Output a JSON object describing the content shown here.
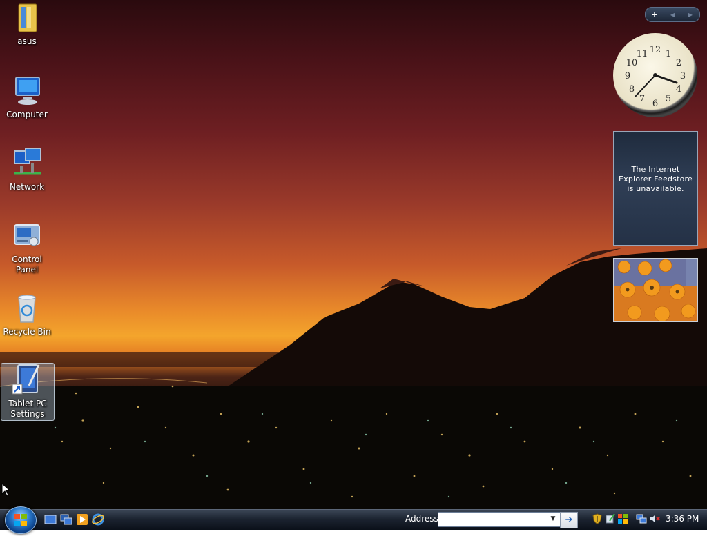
{
  "desktop": {
    "icons": [
      {
        "label": "asus",
        "icon": "folder-icon"
      },
      {
        "label": "Computer",
        "icon": "computer-icon"
      },
      {
        "label": "Network",
        "icon": "network-icon"
      },
      {
        "label": "Control Panel",
        "icon": "control-panel-icon"
      },
      {
        "label": "Recycle Bin",
        "icon": "recycle-bin-icon"
      },
      {
        "label": "Tablet PC Settings",
        "icon": "tablet-pc-settings-icon"
      }
    ]
  },
  "sidebar": {
    "controls": {
      "add": "+",
      "prev": "◀",
      "next": "▶"
    },
    "clock": {
      "numbers": [
        "12",
        "1",
        "2",
        "3",
        "4",
        "5",
        "6",
        "7",
        "8",
        "9",
        "10",
        "11"
      ],
      "time_shown": "3:36"
    },
    "feed_message": "The Internet Explorer Feedstore is unavailable."
  },
  "taskbar": {
    "start_icon": "windows-start-orb-icon",
    "quick_launch": [
      "show-desktop-icon",
      "switch-windows-icon",
      "media-player-icon",
      "internet-explorer-icon"
    ],
    "address_label": "Address",
    "address_value": "",
    "go_glyph": "➔",
    "tray_icons": [
      "security-shield-icon",
      "tablet-input-icon",
      "windows-update-icon",
      "network-connection-icon",
      "volume-muted-icon"
    ],
    "time": "3:36 PM"
  },
  "colors": {
    "taskbar_dark": "#0a0f18",
    "taskbar_light": "#3b4656",
    "feed_bg": "#2f3e55",
    "sunset_orange": "#f4a52c"
  }
}
